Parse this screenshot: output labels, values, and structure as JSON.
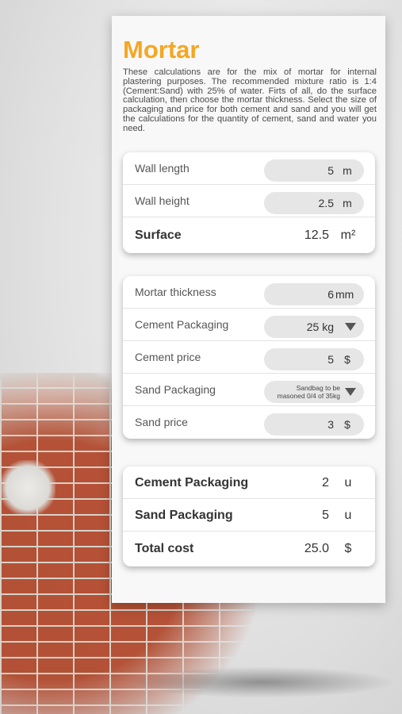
{
  "title": "Mortar",
  "description": "These calculations are for the mix of mortar for internal plastering purposes. The recommended mixture ratio is 1:4 (Cement:Sand) with 25% of water. Firts of all, do the surface calculation, then choose the mortar thickness. Select the size of packaging and price for both cement and sand and you will get the calculations for the quantity of cement, sand and water you need.",
  "surface_card": {
    "wall_length": {
      "label": "Wall length",
      "value": "5",
      "unit": "m"
    },
    "wall_height": {
      "label": "Wall height",
      "value": "2.5",
      "unit": "m"
    },
    "surface": {
      "label": "Surface",
      "value": "12.5",
      "unit": "m²"
    }
  },
  "inputs_card": {
    "mortar_thickness": {
      "label": "Mortar thickness",
      "value": "6",
      "unit": "mm"
    },
    "cement_packaging": {
      "label": "Cement Packaging",
      "value": "25 kg"
    },
    "cement_price": {
      "label": "Cement price",
      "value": "5",
      "unit": "$"
    },
    "sand_packaging": {
      "label": "Sand Packaging",
      "value": "Sandbag to be masoned 0/4 of 35kg"
    },
    "sand_price": {
      "label": "Sand price",
      "value": "3",
      "unit": "$"
    }
  },
  "results_card": {
    "cement_packaging": {
      "label": "Cement Packaging",
      "value": "2",
      "unit": "u"
    },
    "sand_packaging": {
      "label": "Sand Packaging",
      "value": "5",
      "unit": "u"
    },
    "total_cost": {
      "label": "Total cost",
      "value": "25.0",
      "unit": "$"
    }
  },
  "icons": {
    "dropdown": "triangle-down-icon"
  },
  "colors": {
    "accent": "#f5a623"
  }
}
